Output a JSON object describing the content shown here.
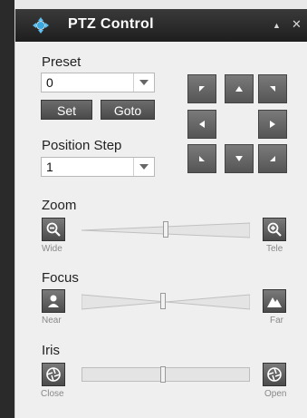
{
  "window": {
    "title": "PTZ Control",
    "minimize_glyph": "▲",
    "close_glyph": "✕"
  },
  "preset": {
    "label": "Preset",
    "value": "0",
    "set_label": "Set",
    "goto_label": "Goto"
  },
  "position_step": {
    "label": "Position Step",
    "value": "1"
  },
  "zoom": {
    "label": "Zoom",
    "wide_label": "Wide",
    "tele_label": "Tele"
  },
  "focus": {
    "label": "Focus",
    "near_label": "Near",
    "far_label": "Far"
  },
  "iris": {
    "label": "Iris",
    "close_label": "Close",
    "open_label": "Open"
  },
  "icons": {
    "title": "ptz-camera-icon",
    "zoom_out": "zoom-out-icon",
    "zoom_in": "zoom-in-icon",
    "focus_near": "person-icon",
    "focus_far": "mountain-icon",
    "iris_close": "aperture-icon",
    "iris_open": "aperture-icon"
  },
  "colors": {
    "titlebar": "#1e1e1e",
    "button": "#555555",
    "panel": "#efefef"
  }
}
